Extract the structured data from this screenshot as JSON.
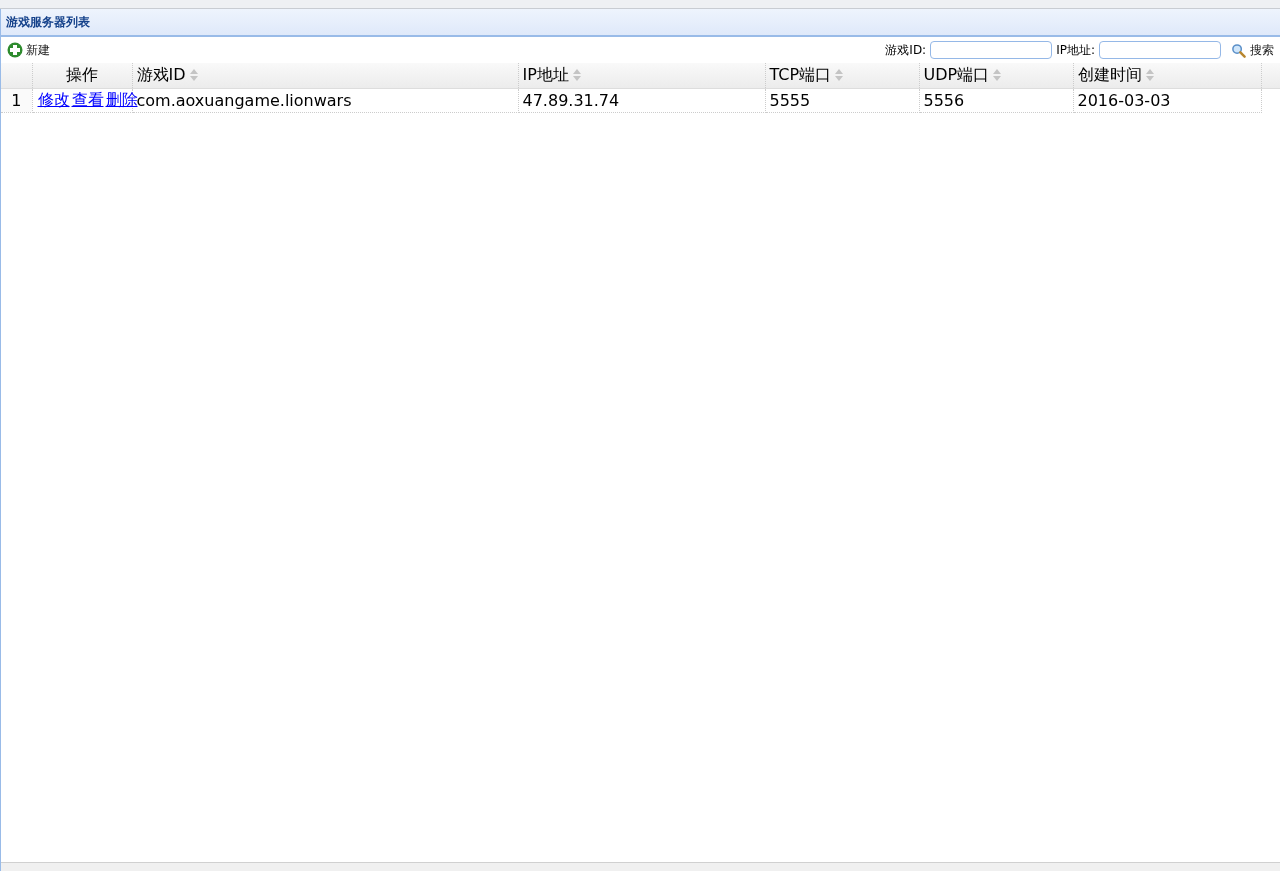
{
  "panel": {
    "title": "游戏服务器列表"
  },
  "toolbar": {
    "new_button": "新建",
    "filters": [
      {
        "label": "游戏ID:"
      },
      {
        "label": "IP地址:"
      }
    ],
    "search_button": "搜索"
  },
  "table": {
    "columns": [
      {
        "label": "操作",
        "sortable": false
      },
      {
        "label": "游戏ID",
        "sortable": true
      },
      {
        "label": "IP地址",
        "sortable": true
      },
      {
        "label": "TCP端口",
        "sortable": true
      },
      {
        "label": "UDP端口",
        "sortable": true
      },
      {
        "label": "创建时间",
        "sortable": true
      }
    ],
    "rows": [
      {
        "number": "1",
        "cells": [
          {
            "links": [
              "修改",
              "查看",
              "删除"
            ]
          },
          {
            "text": "com.aoxuangame.lionwars"
          },
          {
            "text": "47.89.31.74"
          },
          {
            "text": "5555"
          },
          {
            "text": "5556"
          },
          {
            "text": "2016-03-03"
          }
        ]
      }
    ]
  }
}
